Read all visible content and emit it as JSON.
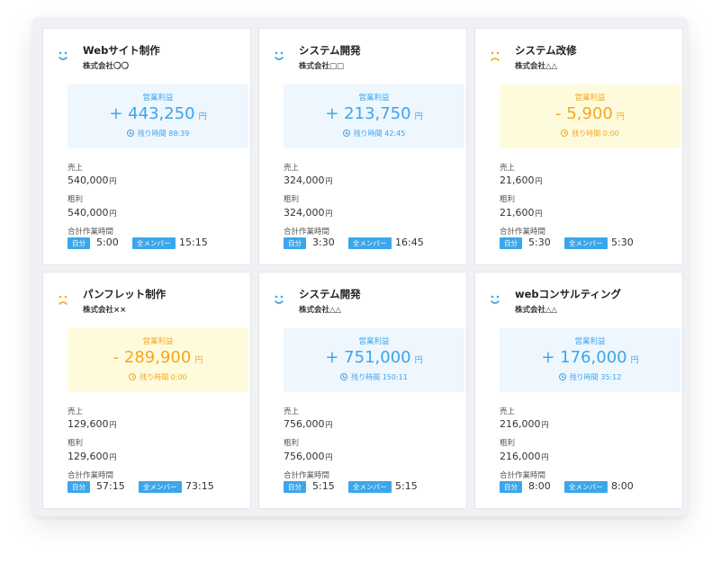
{
  "labels": {
    "profit": "営業利益",
    "remaining_prefix": "残り時間",
    "sales": "売上",
    "gross": "粗利",
    "work_total": "合計作業時間",
    "self": "自分",
    "all_members": "全メンバー",
    "yen": "円"
  },
  "colors": {
    "accent_blue": "#3ba6ea",
    "warning_orange": "#f5a623",
    "blue_bg": "#eef6fe",
    "yellow_bg": "#fefbdc"
  },
  "projects": [
    {
      "title": "Webサイト制作",
      "company": "株式会社〇〇",
      "status": "smile",
      "profit": "+ 443,250",
      "remaining": "88:39",
      "sales": "540,000",
      "gross": "540,000",
      "self_time": "5:00",
      "all_time": "15:15"
    },
    {
      "title": "システム開発",
      "company": "株式会社□□",
      "status": "smile",
      "profit": "+ 213,750",
      "remaining": "42:45",
      "sales": "324,000",
      "gross": "324,000",
      "self_time": "3:30",
      "all_time": "16:45"
    },
    {
      "title": "システム改修",
      "company": "株式会社△△",
      "status": "frown",
      "profit": "- 5,900",
      "remaining": "0:00",
      "sales": "21,600",
      "gross": "21,600",
      "self_time": "5:30",
      "all_time": "5:30"
    },
    {
      "title": "パンフレット制作",
      "company": "株式会社××",
      "status": "frown",
      "profit": "- 289,900",
      "remaining": "0:00",
      "sales": "129,600",
      "gross": "129,600",
      "self_time": "57:15",
      "all_time": "73:15"
    },
    {
      "title": "システム開発",
      "company": "株式会社△△",
      "status": "smile",
      "profit": "+ 751,000",
      "remaining": "150:11",
      "sales": "756,000",
      "gross": "756,000",
      "self_time": "5:15",
      "all_time": "5:15"
    },
    {
      "title": "webコンサルティング",
      "company": "株式会社△△",
      "status": "smile",
      "profit": "+ 176,000",
      "remaining": "35:12",
      "sales": "216,000",
      "gross": "216,000",
      "self_time": "8:00",
      "all_time": "8:00"
    }
  ]
}
